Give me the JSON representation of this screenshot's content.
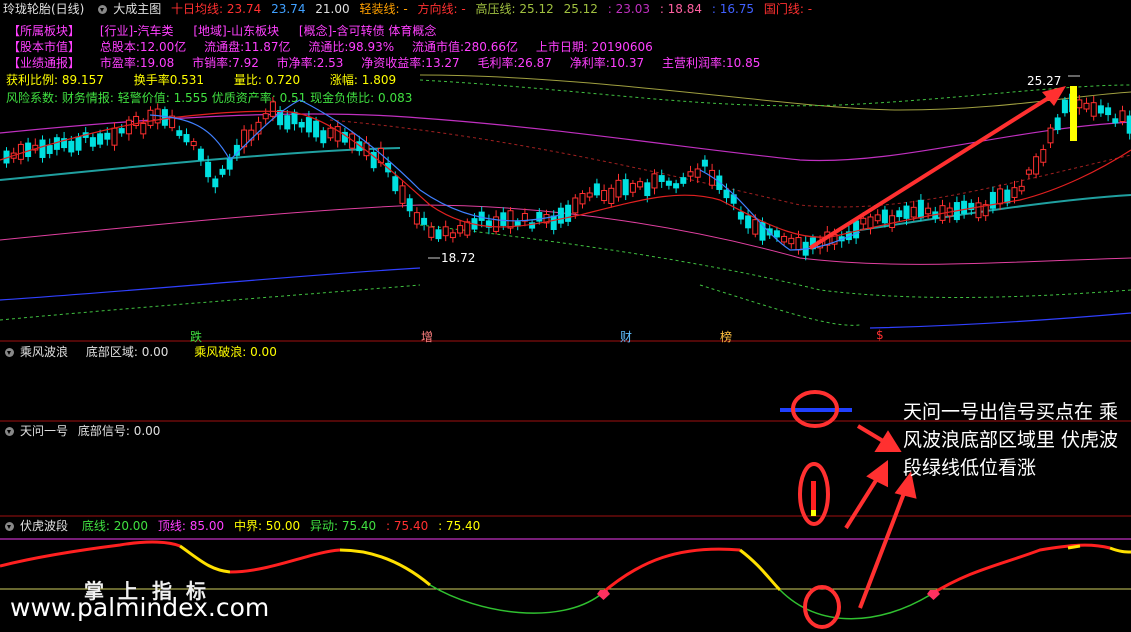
{
  "header": {
    "title": "玲珑轮胎(日线)",
    "indicator": "大成主图",
    "ma_label": "十日均线: ",
    "ma_v1": "23.74",
    "ma_v2": "23.74",
    "ma_v3": "21.00",
    "light_label": "轻装线: -",
    "direction_label": "方向线: -",
    "high_label": "高压线: 25.12",
    "v25": "25.12",
    "v23": ": 23.03",
    "v18": ": 18.84",
    "v16": ": 16.75",
    "guomen": "国门线: -"
  },
  "info": {
    "row1": [
      "【所属板块】",
      "[行业]-汽车类",
      "[地域]-山东板块",
      "[概念]-含可转债 体育概念"
    ],
    "row2": [
      "【股本市值】",
      "总股本:12.00亿",
      "流通盘:11.87亿",
      "流通比:98.93%",
      "流通市值:280.66亿",
      "上市日期: 20190606"
    ],
    "row3": [
      "【业绩通报】",
      "市盈率:19.08",
      "市销率:7.92",
      "市净率:2.53",
      "净资收益率:13.27",
      "毛利率:26.87",
      "净利率:10.37",
      "主营利润率:10.85"
    ],
    "row4": [
      "获利比例:  89.157",
      "换手率0.531",
      "量比:  0.720",
      "涨幅:  1.809"
    ],
    "row5": "风险系数: 财务情报: 轻警价值: 1.555 优质资产率: 0.51 现金负债比: 0.083"
  },
  "price_labels": {
    "high": "25.27",
    "low": "18.72"
  },
  "markers": [
    "跌",
    "增",
    "财",
    "榜",
    "$"
  ],
  "panels": {
    "p1": {
      "name": "乘风波浪",
      "f1": "底部区域: 0.00",
      "f2": "乘风破浪: 0.00"
    },
    "p2": {
      "name": "天问一号",
      "f1": "底部信号: 0.00"
    },
    "p3": {
      "name": "伏虎波段",
      "f1": "底线: 20.00",
      "f2": "顶线: 85.00",
      "f3": "中界: 50.00",
      "f4": "异动: 75.40",
      "f5": ": 75.40",
      "f6": ": 75.40"
    }
  },
  "annotation": "天问一号出信号买点在 乘风波浪底部区域里 伏虎波段绿线低位看涨",
  "watermark": {
    "cn": "掌上指标",
    "url": "www.palmindex.com"
  },
  "colors": {
    "up": "#ff3030",
    "down": "#00e0e0",
    "red_line": "#e02020",
    "yellow": "#ffff00",
    "magenta": "#c030c0",
    "grid": "#800000"
  }
}
